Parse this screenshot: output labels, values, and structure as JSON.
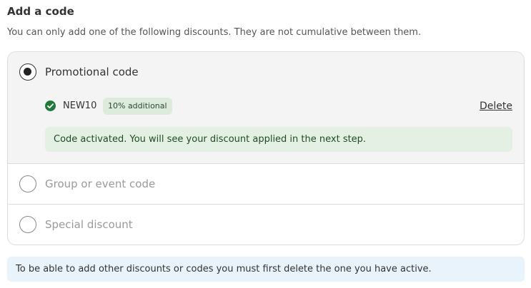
{
  "header": {
    "title": "Add a code",
    "subtitle": "You can only add one of the following discounts. They are not cumulative between them."
  },
  "options": [
    {
      "label": "Promotional code",
      "selected": true,
      "applied_code": {
        "code": "NEW10",
        "badge": "10% additional",
        "delete_label": "Delete",
        "icon": "check-circle-icon"
      },
      "success_message": "Code activated. You will see your discount applied in the next step."
    },
    {
      "label": "Group or event code",
      "selected": false
    },
    {
      "label": "Special discount",
      "selected": false
    }
  ],
  "info_message": "To be able to add other discounts or codes you must first delete the one you have active.",
  "colors": {
    "success_green": "#1f7a3a",
    "success_bg": "#e4f0e4",
    "badge_bg": "#dcebdc",
    "info_bg": "#e8f3fb",
    "selected_option_bg": "#f4f4f4",
    "disabled_text": "#9a9a9a"
  }
}
